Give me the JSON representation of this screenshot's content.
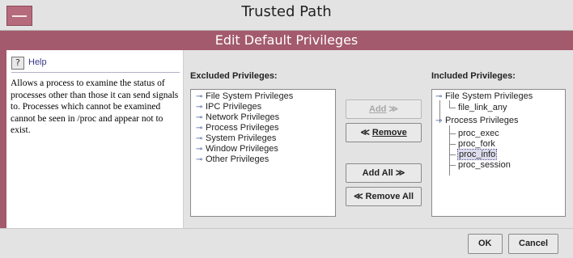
{
  "window": {
    "title": "Trusted Path",
    "subtitle": "Edit Default Privileges"
  },
  "help": {
    "title": "Help",
    "body": "Allows a process to examine the status of processes other than those it can send signals to. Processes which cannot be examined cannot be seen in /proc and appear not to exist."
  },
  "excluded": {
    "label": "Excluded Privileges:",
    "items": [
      "File System Privileges",
      "IPC Privileges",
      "Network Privileges",
      "Process Privileges",
      "System Privileges",
      "Window Privileges",
      "Other Privileges"
    ]
  },
  "buttons": {
    "add": "Add",
    "add_arrow": "≫",
    "remove": "Remove",
    "remove_arrow": "≪",
    "add_all": "Add All",
    "add_all_arrow": "≫",
    "remove_all": "Remove All",
    "remove_all_arrow": "≪",
    "ok": "OK",
    "cancel": "Cancel"
  },
  "included": {
    "label": "Included Privileges:",
    "groups": [
      {
        "label": "File System Privileges",
        "children": [
          "file_link_any"
        ]
      },
      {
        "label": "Process Privileges",
        "children": [
          "proc_exec",
          "proc_fork",
          "proc_info",
          "proc_session"
        ]
      }
    ],
    "selected": "proc_info"
  },
  "colors": {
    "accent": "#a35a6c",
    "panel": "#e3e3e3"
  }
}
